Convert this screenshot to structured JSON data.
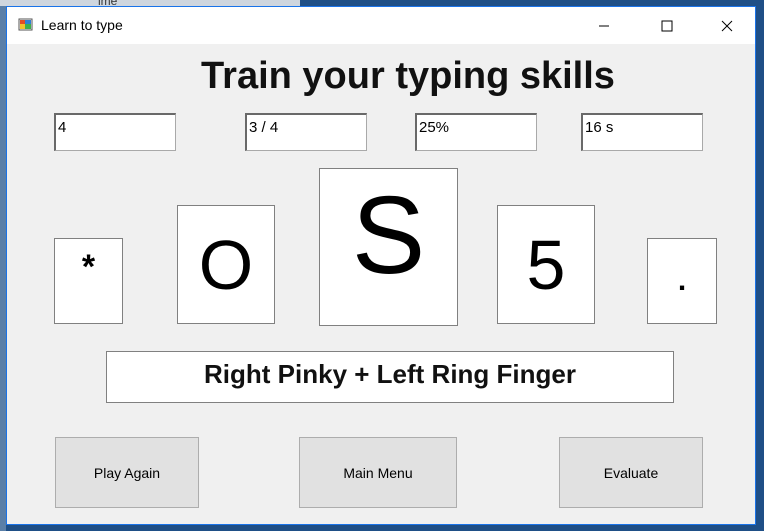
{
  "window": {
    "title": "Learn to type"
  },
  "heading": "Train your typing skills",
  "stats": {
    "box1": "4",
    "box2": "3 / 4",
    "box3": "25%",
    "box4": "16 s"
  },
  "keys": {
    "far_left": "*",
    "left": "O",
    "current": "S",
    "right": "5",
    "far_right": "."
  },
  "finger_hint": "Right Pinky + Left Ring Finger",
  "buttons": {
    "play_again": "Play Again",
    "main_menu": "Main Menu",
    "evaluate": "Evaluate"
  },
  "background_text": "ime",
  "colors": {
    "window_border": "#1a73e8",
    "taskbar": "#1f4f86"
  }
}
